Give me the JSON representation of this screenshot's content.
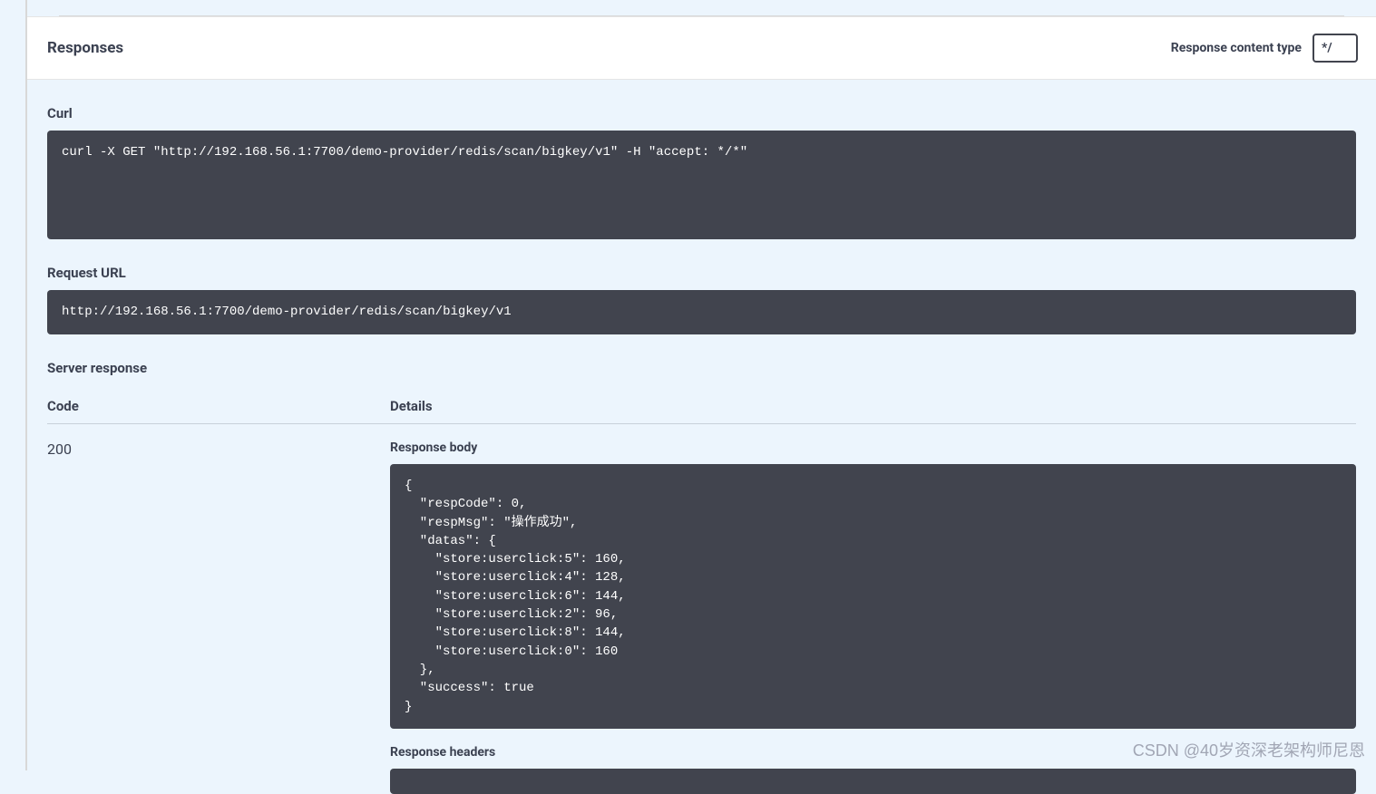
{
  "responses": {
    "title": "Responses",
    "content_type_label": "Response content type",
    "content_type_value": "*/"
  },
  "curl": {
    "label": "Curl",
    "command": "curl -X GET \"http://192.168.56.1:7700/demo-provider/redis/scan/bigkey/v1\" -H \"accept: */*\""
  },
  "request_url": {
    "label": "Request URL",
    "value": "http://192.168.56.1:7700/demo-provider/redis/scan/bigkey/v1"
  },
  "server_response": {
    "label": "Server response",
    "code_header": "Code",
    "details_header": "Details",
    "code_value": "200",
    "response_body_label": "Response body",
    "response_body": "{\n  \"respCode\": 0,\n  \"respMsg\": \"操作成功\",\n  \"datas\": {\n    \"store:userclick:5\": 160,\n    \"store:userclick:4\": 128,\n    \"store:userclick:6\": 144,\n    \"store:userclick:2\": 96,\n    \"store:userclick:8\": 144,\n    \"store:userclick:0\": 160\n  },\n  \"success\": true\n}",
    "response_headers_label": "Response headers"
  },
  "watermark": "CSDN @40岁资深老架构师尼恩"
}
